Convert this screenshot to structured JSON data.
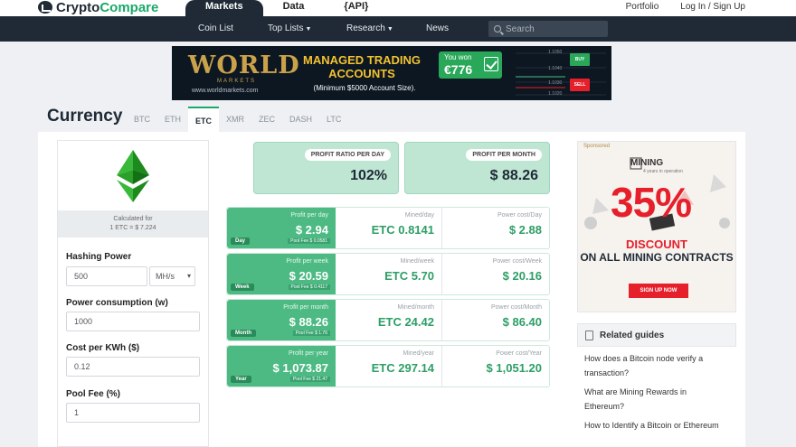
{
  "header": {
    "logo_crypto": "Crypto",
    "logo_compare": "Compare",
    "tabs": [
      {
        "label": "Markets"
      },
      {
        "label": "Data"
      },
      {
        "label": "{API}"
      }
    ],
    "links": [
      {
        "label": "Portfolio"
      },
      {
        "label": "Log In / Sign Up"
      }
    ]
  },
  "subnav": {
    "items": [
      {
        "label": "Coin List"
      },
      {
        "label": "Top Lists"
      },
      {
        "label": "Research"
      },
      {
        "label": "News"
      }
    ],
    "search_placeholder": "Search"
  },
  "banner": {
    "brand": "WORLD",
    "brand_sub": "MARKETS",
    "url": "www.worldmarkets.com",
    "headline": "MANAGED TRADING ACCOUNTS",
    "note": "(Minimum $5000 Account Size).",
    "won_label": "You won",
    "won_amount": "€776",
    "buy": "BUY",
    "sell": "SELL",
    "price_1": "1.1050",
    "price_2": "1.1040",
    "price_3": "1.1030",
    "price_4": "1.1020"
  },
  "currency": {
    "title": "Currency",
    "tabs": [
      {
        "label": "BTC"
      },
      {
        "label": "ETH"
      },
      {
        "label": "ETC"
      },
      {
        "label": "XMR"
      },
      {
        "label": "ZEC"
      },
      {
        "label": "DASH"
      },
      {
        "label": "LTC"
      }
    ],
    "active_tab": "ETC"
  },
  "calculator": {
    "calc_label": "Calculated for",
    "calc_rate": "1 ETC = $ 7.224",
    "hashing_label": "Hashing Power",
    "hashing_value": "500",
    "hashing_unit": "MH/s",
    "power_label": "Power consumption (w)",
    "power_value": "1000",
    "cost_label": "Cost per KWh ($)",
    "cost_value": "0.12",
    "fee_label": "Pool Fee (%)",
    "fee_value": "1"
  },
  "ratios": {
    "profit_ratio_label": "PROFIT RATIO PER DAY",
    "profit_ratio_value": "102%",
    "profit_month_label": "PROFIT PER MONTH",
    "profit_month_value": "$ 88.26"
  },
  "rows": [
    {
      "tag": "Day",
      "profit_label": "Profit per day",
      "profit": "$ 2.94",
      "fee": "Pool Fee $ 0.0581",
      "mined_label": "Mined/day",
      "mined": "ETC 0.8141",
      "power_label": "Power cost/Day",
      "power": "$ 2.88"
    },
    {
      "tag": "Week",
      "profit_label": "Profit per week",
      "profit": "$ 20.59",
      "fee": "Pool Fee $ 0.4117",
      "mined_label": "Mined/week",
      "mined": "ETC 5.70",
      "power_label": "Power cost/Week",
      "power": "$ 20.16"
    },
    {
      "tag": "Month",
      "profit_label": "Profit per month",
      "profit": "$ 88.26",
      "fee": "Pool Fee $ 1.76",
      "mined_label": "Mined/month",
      "mined": "ETC 24.42",
      "power_label": "Power cost/Month",
      "power": "$ 86.40"
    },
    {
      "tag": "Year",
      "profit_label": "Profit per year",
      "profit": "$ 1,073.87",
      "fee": "Pool Fee $ 21.47",
      "mined_label": "Mined/year",
      "mined": "ETC 297.14",
      "power_label": "Power cost/Year",
      "power": "$ 1,051.20"
    }
  ],
  "ad": {
    "sponsored": "Sponsored",
    "brand": "MINING",
    "brand_sub": "4 years in operation",
    "percent": "35%",
    "line1": "DISCOUNT",
    "line2": "ON ALL MINING CONTRACTS",
    "cta": "SIGN UP NOW"
  },
  "guides": {
    "title": "Related guides",
    "items": [
      {
        "label": "How does a Bitcoin node verify a transaction?"
      },
      {
        "label": "What are Mining Rewards in Ethereum?"
      },
      {
        "label": "How to Identify a Bitcoin or Ethereum"
      }
    ]
  },
  "colors": {
    "brand_green": "#1aa869",
    "navy": "#1f2a36",
    "row_green": "#4cba82",
    "ad_red": "#e5202b"
  }
}
